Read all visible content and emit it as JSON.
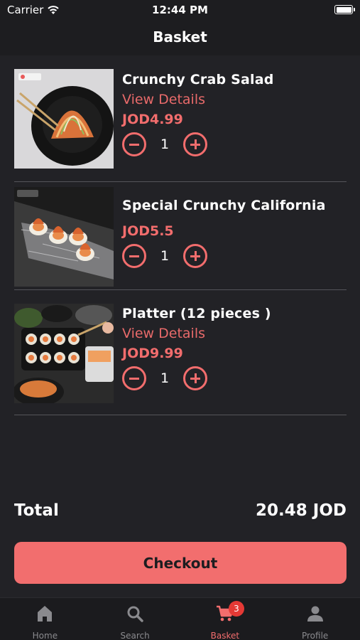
{
  "status_bar": {
    "carrier": "Carrier",
    "time": "12:44 PM"
  },
  "header": {
    "title": "Basket"
  },
  "items": [
    {
      "name": "Crunchy Crab Salad",
      "details": "View Details",
      "price": "JOD4.99",
      "quantity": "1",
      "image": "crab-salad-photo"
    },
    {
      "name": "Special Crunchy California",
      "details": "",
      "price": "JOD5.5",
      "quantity": "1",
      "image": "california-roll-photo"
    },
    {
      "name": "Platter (12 pieces )",
      "details": "View Details",
      "price": "JOD9.99",
      "quantity": "1",
      "image": "sushi-platter-photo"
    }
  ],
  "summary": {
    "total_label": "Total",
    "total_value": "20.48 JOD"
  },
  "checkout_label": "Checkout",
  "tabs": [
    {
      "label": "Home",
      "icon": "home-icon"
    },
    {
      "label": "Search",
      "icon": "search-icon"
    },
    {
      "label": "Basket",
      "icon": "cart-icon",
      "active": true,
      "badge": "3"
    },
    {
      "label": "Profile",
      "icon": "person-icon"
    }
  ],
  "colors": {
    "accent": "#f26d6d",
    "background": "#222226",
    "bar": "#1d1d20",
    "badge": "#e53935"
  }
}
